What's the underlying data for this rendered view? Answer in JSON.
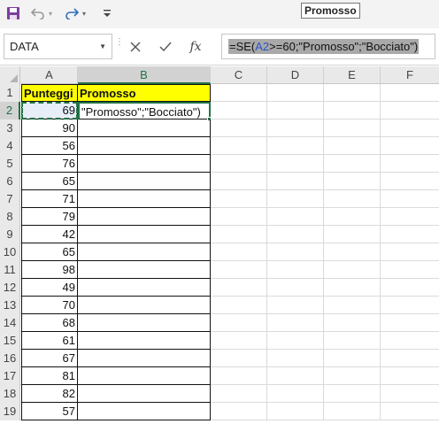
{
  "toolbar": {
    "tooltip": "Promosso"
  },
  "formula_bar": {
    "name_box": "DATA",
    "formula_prefix": "=SE(",
    "formula_ref": "A2",
    "formula_suffix": ">=60;\"Promosso\";\"Bocciato\")"
  },
  "columns": [
    "A",
    "B",
    "C",
    "D",
    "E",
    "F"
  ],
  "header_row": {
    "number": "1",
    "a": "Punteggi",
    "b": "Promosso"
  },
  "rows": [
    {
      "number": "2",
      "a": "69",
      "b": "\"Promosso\";\"Bocciato\")"
    },
    {
      "number": "3",
      "a": "90",
      "b": ""
    },
    {
      "number": "4",
      "a": "56",
      "b": ""
    },
    {
      "number": "5",
      "a": "76",
      "b": ""
    },
    {
      "number": "6",
      "a": "65",
      "b": ""
    },
    {
      "number": "7",
      "a": "71",
      "b": ""
    },
    {
      "number": "8",
      "a": "79",
      "b": ""
    },
    {
      "number": "9",
      "a": "42",
      "b": ""
    },
    {
      "number": "10",
      "a": "65",
      "b": ""
    },
    {
      "number": "11",
      "a": "98",
      "b": ""
    },
    {
      "number": "12",
      "a": "49",
      "b": ""
    },
    {
      "number": "13",
      "a": "70",
      "b": ""
    },
    {
      "number": "14",
      "a": "68",
      "b": ""
    },
    {
      "number": "15",
      "a": "61",
      "b": ""
    },
    {
      "number": "16",
      "a": "67",
      "b": ""
    },
    {
      "number": "17",
      "a": "81",
      "b": ""
    },
    {
      "number": "18",
      "a": "82",
      "b": ""
    },
    {
      "number": "19",
      "a": "57",
      "b": ""
    }
  ],
  "selection": {
    "active_column": "B",
    "active_row": "2"
  },
  "colors": {
    "accent": "#217346",
    "header_fill": "#ffff00",
    "formula_ref": "#2a55c6"
  }
}
